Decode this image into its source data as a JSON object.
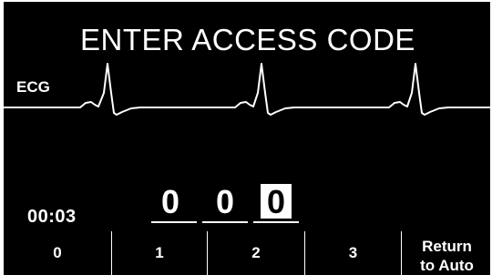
{
  "screen": {
    "title": "ENTER ACCESS CODE",
    "ecg_label": "ECG",
    "timer": "00:03"
  },
  "access_code": {
    "digits": [
      "0",
      "0",
      "0"
    ],
    "active_index": 2
  },
  "softkeys": [
    {
      "label": "0"
    },
    {
      "label": "1"
    },
    {
      "label": "2"
    },
    {
      "label": "3"
    },
    {
      "label_line1": "Return",
      "label_line2": "to Auto"
    }
  ],
  "colors": {
    "background": "#000000",
    "foreground": "#ffffff"
  }
}
